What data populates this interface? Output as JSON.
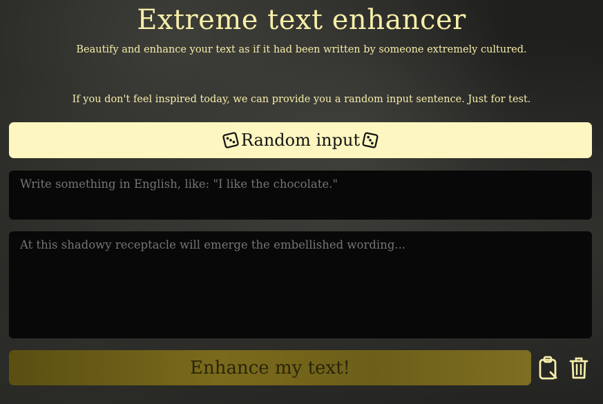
{
  "header": {
    "title": "Extreme text enhancer",
    "subtitle": "Beautify and enhance your text as if it had been written by someone extremely cultured."
  },
  "random": {
    "hint": "If you don't feel inspired today, we can provide you a random input sentence. Just for test.",
    "button_label": "Random input",
    "icon": "dice-icon"
  },
  "input": {
    "placeholder": "Write something in English, like: \"I like the chocolate.\"",
    "value": ""
  },
  "output": {
    "placeholder": "At this shadowy receptacle will emerge the embellished wording...",
    "value": ""
  },
  "actions": {
    "enhance_label": "Enhance my text!",
    "copy_icon": "clipboard-icon",
    "clear_icon": "trash-icon"
  },
  "colors": {
    "accent": "#f6eeaa",
    "button_light": "#fdf6c0",
    "button_gold": "#7a6a1c",
    "textbox_bg": "#080808"
  }
}
